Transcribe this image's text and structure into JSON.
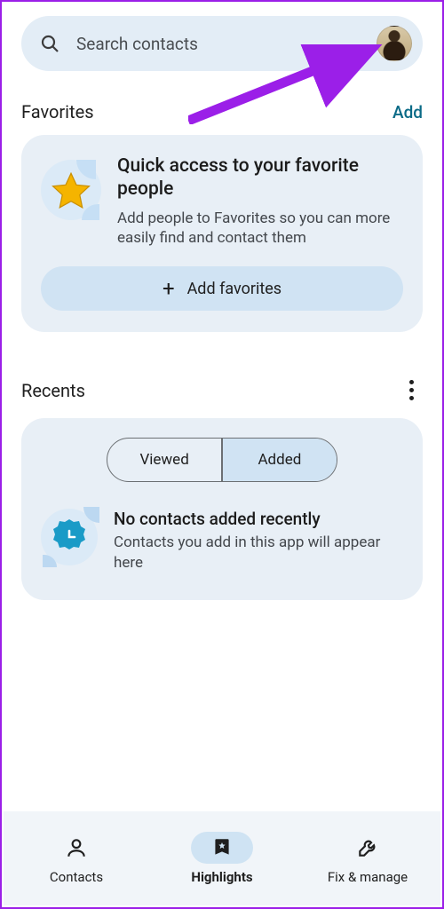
{
  "search": {
    "placeholder": "Search contacts"
  },
  "favorites": {
    "heading": "Favorites",
    "add_link": "Add",
    "card_title": "Quick access to your favorite people",
    "card_body": "Add people to Favorites so you can more easily find and contact them",
    "button": "Add favorites"
  },
  "recents": {
    "heading": "Recents",
    "seg_viewed": "Viewed",
    "seg_added": "Added",
    "selected_segment": "Added",
    "empty_title": "No contacts added recently",
    "empty_body": "Contacts you add in this app will appear here"
  },
  "nav": {
    "contacts": "Contacts",
    "highlights": "Highlights",
    "fix": "Fix & manage",
    "active": "Highlights"
  },
  "colors": {
    "annotation_arrow": "#9b1fe8",
    "card_bg": "#e8eff6",
    "accent_link": "#0b6b87"
  }
}
